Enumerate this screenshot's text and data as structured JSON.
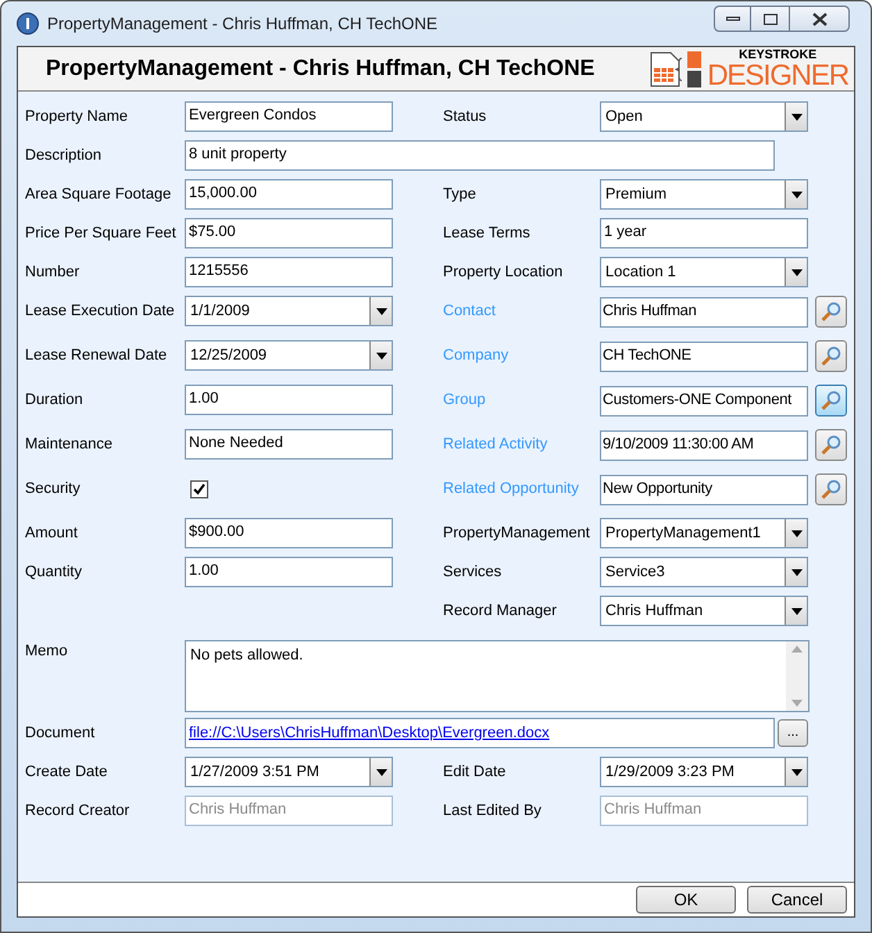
{
  "window": {
    "title": "PropertyManagement - Chris Huffman, CH TechONE"
  },
  "header": {
    "title": "PropertyManagement - Chris Huffman, CH TechONE",
    "logo_top": "KEYSTROKE",
    "logo_bottom": "DESIGNER"
  },
  "rows": [
    [
      {
        "label": "Property Name",
        "kind": "text",
        "value": "Evergreen Condos"
      },
      {
        "label": "Status",
        "kind": "combo",
        "value": "Open"
      }
    ],
    [
      {
        "label": "Description",
        "kind": "wide",
        "value": "8 unit property"
      }
    ],
    [
      {
        "label": "Area Square Footage",
        "kind": "text",
        "value": "15,000.00"
      },
      {
        "label": "Type",
        "kind": "combo",
        "value": "Premium"
      }
    ],
    [
      {
        "label": "Price Per Square Feet",
        "kind": "text",
        "value": "$75.00"
      },
      {
        "label": "Lease Terms",
        "kind": "text",
        "value": "1 year"
      }
    ],
    [
      {
        "label": "Number",
        "kind": "text",
        "value": "1215556"
      },
      {
        "label": "Property Location",
        "kind": "combo",
        "value": "Location 1"
      }
    ],
    [
      {
        "label": "Lease Execution Date",
        "kind": "date",
        "value": "1/1/2009"
      },
      {
        "label": "Contact",
        "kind": "lookup",
        "value": "Chris Huffman",
        "hovered": false
      }
    ],
    [
      {
        "label": "Lease Renewal Date",
        "kind": "date",
        "value": "12/25/2009"
      },
      {
        "label": "Company",
        "kind": "lookup",
        "value": "CH TechONE",
        "hovered": false
      }
    ],
    [
      {
        "label": "Duration",
        "kind": "text",
        "value": "1.00"
      },
      {
        "label": "Group",
        "kind": "lookup",
        "value": "Customers-ONE Component",
        "hovered": true
      }
    ],
    [
      {
        "label": "Maintenance",
        "kind": "text",
        "value": "None Needed"
      },
      {
        "label": "Related Activity",
        "kind": "lookup",
        "value": "9/10/2009 11:30:00 AM",
        "hovered": false
      }
    ],
    [
      {
        "label": "Security",
        "kind": "check",
        "checked": true
      },
      {
        "label": "Related Opportunity",
        "kind": "lookup",
        "value": "New Opportunity",
        "hovered": false
      }
    ],
    [
      {
        "label": "Amount",
        "kind": "text",
        "value": "$900.00"
      },
      {
        "label": "PropertyManagement",
        "kind": "combo",
        "value": "PropertyManagement1"
      }
    ],
    [
      {
        "label": "Quantity",
        "kind": "text",
        "value": "1.00"
      },
      {
        "label": "Services",
        "kind": "combo",
        "value": "Service3"
      }
    ],
    [
      null,
      {
        "label": "Record Manager",
        "kind": "combo",
        "value": "Chris Huffman"
      }
    ],
    [
      {
        "label": "Memo",
        "kind": "memo",
        "value": "No pets allowed."
      }
    ],
    [
      {
        "label": "Document",
        "kind": "link",
        "value": "file://C:\\Users\\ChrisHuffman\\Desktop\\Evergreen.docx",
        "button": "..."
      }
    ],
    [
      {
        "label": "Create Date",
        "kind": "date",
        "value": "1/27/2009 3:51 PM"
      },
      {
        "label": "Edit Date",
        "kind": "date",
        "value": "1/29/2009 3:23 PM"
      }
    ],
    [
      {
        "label": "Record Creator",
        "kind": "readonly",
        "value": "Chris Huffman"
      },
      {
        "label": "Last Edited By",
        "kind": "readonly",
        "value": "Chris Huffman"
      }
    ]
  ],
  "buttons": [
    "OK",
    "Cancel"
  ]
}
